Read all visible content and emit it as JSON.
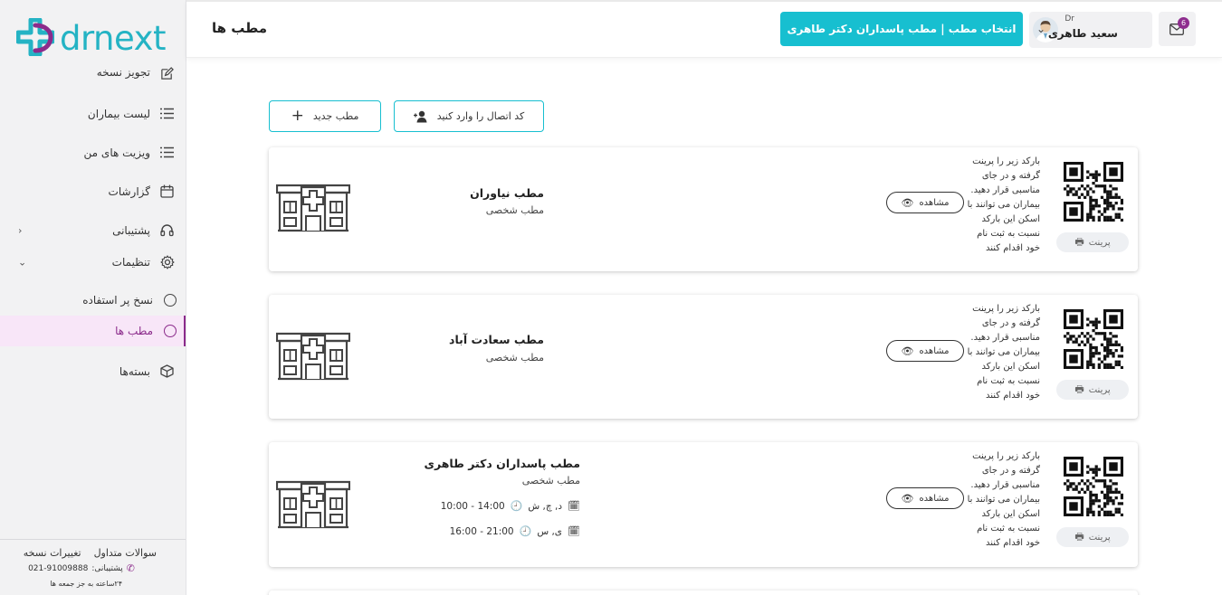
{
  "logo": {
    "text": "drnext"
  },
  "header": {
    "title": "مطب ها"
  },
  "clinic_selector": {
    "label": "انتخاب مطب | مطب پاسداران دکتر طاهری"
  },
  "user": {
    "prefix": "Dr",
    "name": "سعید طاهری"
  },
  "mail": {
    "badge": "6"
  },
  "sidebar": {
    "items": [
      {
        "label": "تجویز نسخه",
        "icon": "edit-icon"
      },
      {
        "label": "لیست بیماران",
        "icon": "list-icon"
      },
      {
        "label": "ویزیت های من",
        "icon": "list-icon"
      },
      {
        "label": "گزارشات",
        "icon": "calendar-icon"
      },
      {
        "label": "پشتیبانی",
        "icon": "headset-icon"
      },
      {
        "label": "تنظیمات",
        "icon": "gear-icon"
      },
      {
        "label": "نسخ پر استفاده",
        "icon": "circle-icon"
      },
      {
        "label": "مطب ها",
        "icon": "circle-icon"
      },
      {
        "label": "بسته‌ها",
        "icon": "box-icon"
      }
    ],
    "footer": {
      "faq": "سوالات متداول",
      "changes": "تغییرات نسخه",
      "support_label": "پشتیبانی:",
      "support_phone": "021-91009888",
      "hours": "۲۴ساعته به جز جمعه ها"
    }
  },
  "actions": {
    "new_clinic": "مطب جدید",
    "enter_code": "کد اتصال را وارد کنید"
  },
  "common": {
    "print": "پرینت",
    "view": "مشاهده",
    "qr_line1": "بارکد زیر را پرینت",
    "qr_line2": "گرفته و در جای",
    "qr_line3": "مناسبی قرار دهید.",
    "qr_line4": "بیماران می توانند با",
    "qr_line5": "اسکن این بارکد",
    "qr_line6": "نسبت به ثبت نام",
    "qr_line7": "خود اقدام کنند"
  },
  "clinics": [
    {
      "name": "مطب نیاوران",
      "type": "مطب شخصی"
    },
    {
      "name": "مطب سعادت آباد",
      "type": "مطب شخصی"
    },
    {
      "name": "مطب پاسداران دکتر طاهری",
      "type": "مطب شخصی",
      "schedule": [
        {
          "time": "14:00 - 10:00",
          "days": "د, چ, ش"
        },
        {
          "time": "21:00 - 16:00",
          "days": "ی, س"
        }
      ]
    }
  ],
  "colors": {
    "accent": "#17bfd0",
    "brand_purple": "#8b2b8b",
    "active_bg": "#f8e6f8"
  }
}
